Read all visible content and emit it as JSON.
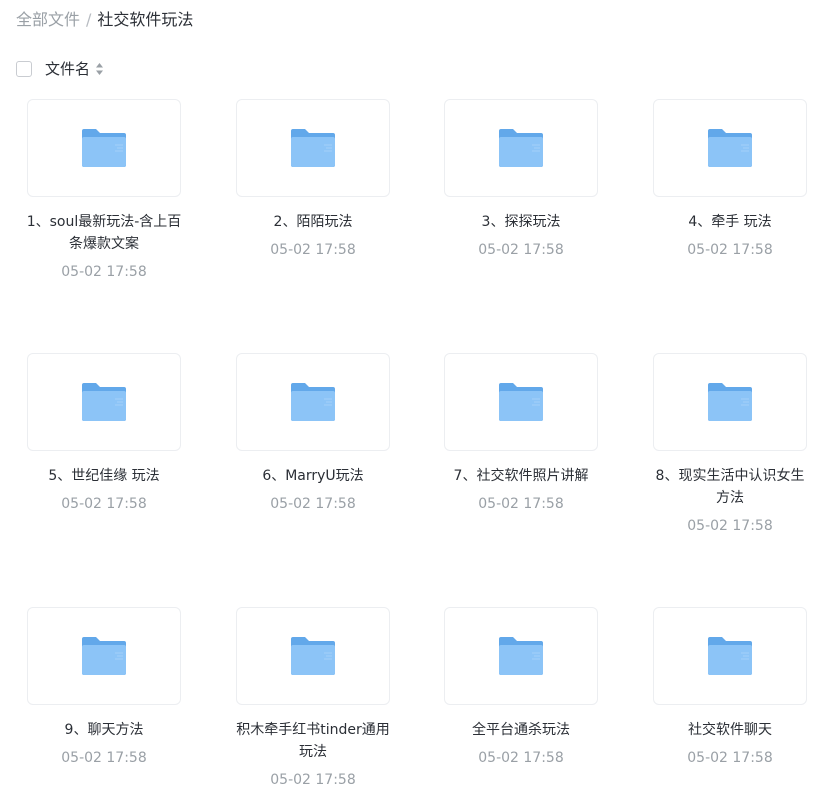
{
  "breadcrumb": {
    "root": "全部文件",
    "separator": "/",
    "current": "社交软件玩法"
  },
  "list_header": {
    "column_label": "文件名",
    "sort_icon": "sort-up-down-icon"
  },
  "colors": {
    "folder_back": "#62a8ea",
    "folder_front": "#8cc4f7",
    "folder_tab": "#4f98e0",
    "muted_text": "#9aa0a6",
    "card_border": "#eceef1"
  },
  "folders": [
    {
      "name": "1、soul最新玩法-含上百条爆款文案",
      "date": "05-02 17:58",
      "icon": "folder-icon"
    },
    {
      "name": "2、陌陌玩法",
      "date": "05-02 17:58",
      "icon": "folder-icon"
    },
    {
      "name": "3、探探玩法",
      "date": "05-02 17:58",
      "icon": "folder-icon"
    },
    {
      "name": "4、牵手 玩法",
      "date": "05-02 17:58",
      "icon": "folder-icon"
    },
    {
      "name": "5、世纪佳缘 玩法",
      "date": "05-02 17:58",
      "icon": "folder-icon"
    },
    {
      "name": "6、MarryU玩法",
      "date": "05-02 17:58",
      "icon": "folder-icon"
    },
    {
      "name": "7、社交软件照片讲解",
      "date": "05-02 17:58",
      "icon": "folder-icon"
    },
    {
      "name": "8、现实生活中认识女生方法",
      "date": "05-02 17:58",
      "icon": "folder-icon"
    },
    {
      "name": "9、聊天方法",
      "date": "05-02 17:58",
      "icon": "folder-icon"
    },
    {
      "name": "积木牵手红书tinder通用玩法",
      "date": "05-02 17:58",
      "icon": "folder-icon"
    },
    {
      "name": "全平台通杀玩法",
      "date": "05-02 17:58",
      "icon": "folder-icon"
    },
    {
      "name": "社交软件聊天",
      "date": "05-02 17:58",
      "icon": "folder-icon"
    }
  ]
}
